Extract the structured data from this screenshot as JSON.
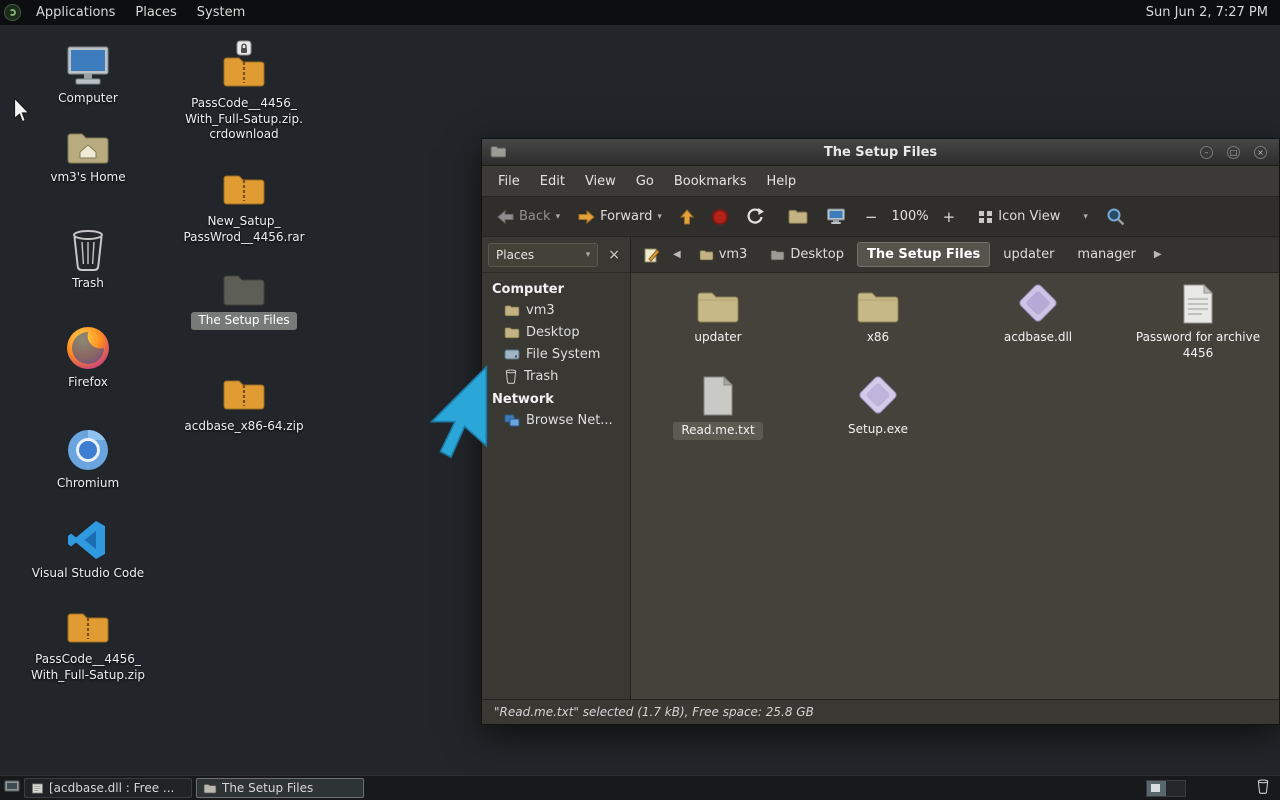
{
  "panel": {
    "menus": [
      "Applications",
      "Places",
      "System"
    ],
    "clock": "Sun Jun 2, 7:27 PM"
  },
  "desktop": {
    "computer": "Computer",
    "home": "vm3's Home",
    "trash": "Trash",
    "firefox": "Firefox",
    "chromium": "Chromium",
    "vscode": "Visual Studio Code",
    "zip1": "PassCode__4456_\nWith_Full-Satup.zip",
    "crdownload": "PassCode__4456_\nWith_Full-Satup.zip.\ncrdownload",
    "rar": "New_Satup_\nPassWrod__4456.rar",
    "setup_folder": "The Setup Files",
    "zip2": "acdbase_x86-64.zip"
  },
  "window": {
    "title": "The Setup Files",
    "menubar": [
      "File",
      "Edit",
      "View",
      "Go",
      "Bookmarks",
      "Help"
    ],
    "toolbar": {
      "back": "Back",
      "forward": "Forward",
      "zoom_out": "−",
      "zoom_level": "100%",
      "zoom_in": "+",
      "view_mode": "Icon View"
    },
    "breadcrumbs": [
      "vm3",
      "Desktop",
      "The Setup Files",
      "updater",
      "manager"
    ],
    "sidebar": {
      "pane_selector": "Places",
      "section1": "Computer",
      "section1_items": [
        "vm3",
        "Desktop",
        "File System",
        "Trash"
      ],
      "section2": "Network",
      "section2_items": [
        "Browse Net..."
      ]
    },
    "files": [
      {
        "name": "updater"
      },
      {
        "name": "x86"
      },
      {
        "name": "acdbase.dll"
      },
      {
        "name": "Password for archive\n4456"
      },
      {
        "name": "Read.me.txt"
      },
      {
        "name": "Setup.exe"
      }
    ],
    "statusbar": "\"Read.me.txt\" selected (1.7 kB), Free space: 25.8 GB"
  },
  "taskbar": {
    "window1": "[acdbase.dll : Free ...",
    "window2": "The Setup Files"
  }
}
